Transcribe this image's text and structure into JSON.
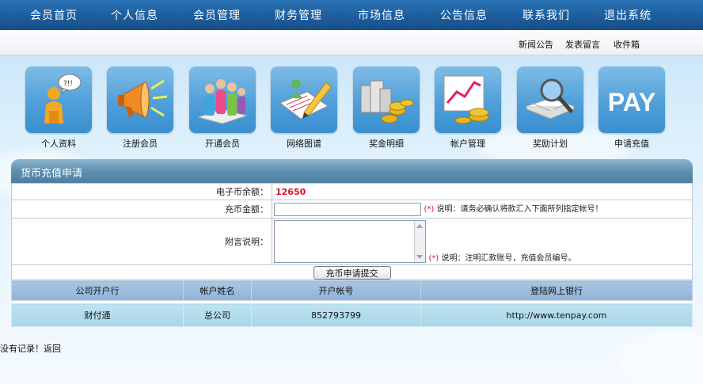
{
  "nav": {
    "items": [
      "会员首页",
      "个人信息",
      "会员管理",
      "财务管理",
      "市场信息",
      "公告信息",
      "联系我们",
      "退出系统"
    ]
  },
  "subnav": {
    "items": [
      "新闻公告",
      "发表留言",
      "收件箱"
    ]
  },
  "tiles": [
    {
      "label": "个人资料",
      "icon": "person-info-icon"
    },
    {
      "label": "注册会员",
      "icon": "megaphone-icon"
    },
    {
      "label": "开通会员",
      "icon": "people-group-icon"
    },
    {
      "label": "网络图谱",
      "icon": "pencil-document-icon"
    },
    {
      "label": "奖金明细",
      "icon": "coins-icon"
    },
    {
      "label": "帐户管理",
      "icon": "chart-coins-icon"
    },
    {
      "label": "奖励计划",
      "icon": "magnifier-book-icon"
    },
    {
      "label": "申请充值",
      "icon": "pay-icon",
      "icon_text": "PAY"
    }
  ],
  "panel": {
    "title": "货币充值申请",
    "balance_label": "电子币余额：",
    "balance_value": "12650",
    "amount_label": "充币金额：",
    "amount_value": "",
    "amount_note_star": "(*)",
    "amount_note": "说明：请务必确认将款汇入下面所列指定帐号！",
    "remark_label": "附言说明：",
    "remark_value": "",
    "remark_note_star": "(*)",
    "remark_note": "说明：注明汇款账号，充值会员编号。",
    "submit_label": "充币申请提交"
  },
  "bank_table": {
    "headers": [
      "公司开户行",
      "帐户姓名",
      "开户帐号",
      "登陆网上银行"
    ],
    "rows": [
      [
        "财付通",
        "总公司",
        "852793799",
        "http://www.tenpay.com"
      ]
    ]
  },
  "footer": {
    "text": "没有记录！",
    "back_link": "返回"
  },
  "colors": {
    "nav_bg": "#1d5d9d",
    "tile_bg": "#4f9fd9",
    "panel_header": "#5e8fae",
    "accent_red": "#e0102a"
  }
}
